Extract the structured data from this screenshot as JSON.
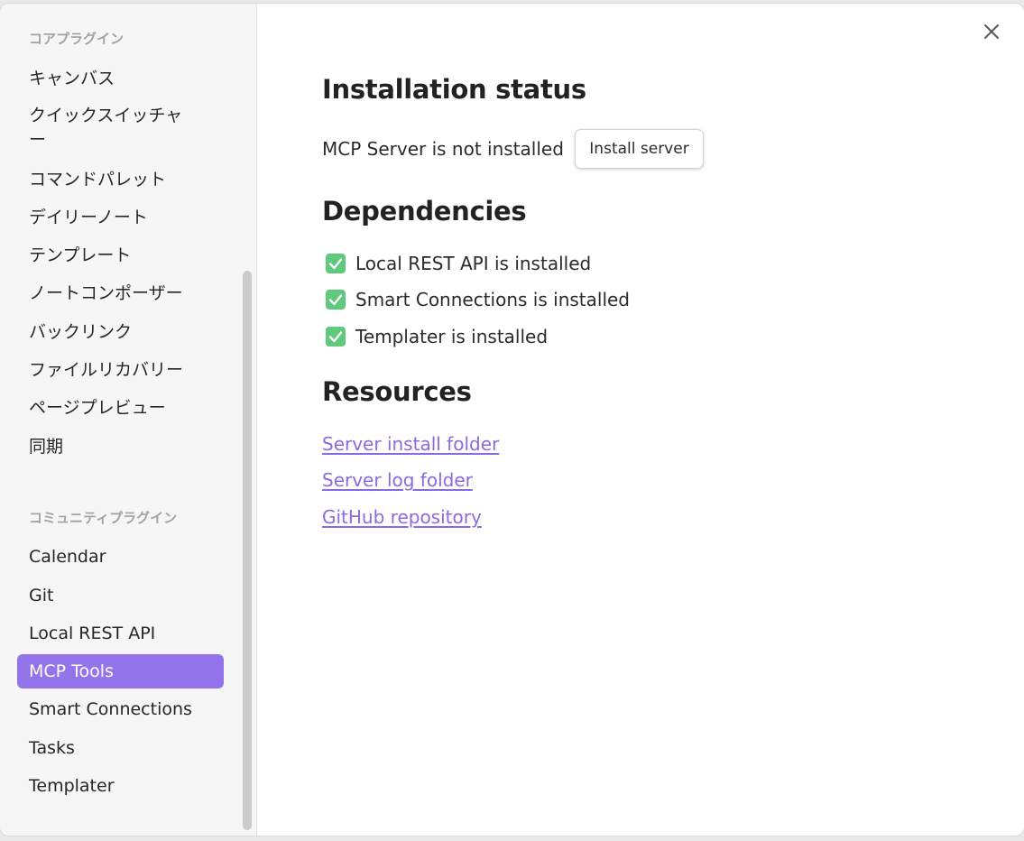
{
  "sidebar": {
    "core_heading": "コアプラグイン",
    "core_items": [
      {
        "label": "キャンバス"
      },
      {
        "label": "クイックスイッチャー"
      },
      {
        "label": "コマンドパレット"
      },
      {
        "label": "デイリーノート"
      },
      {
        "label": "テンプレート"
      },
      {
        "label": "ノートコンポーザー"
      },
      {
        "label": "バックリンク"
      },
      {
        "label": "ファイルリカバリー"
      },
      {
        "label": "ページプレビュー"
      },
      {
        "label": "同期"
      }
    ],
    "community_heading": "コミュニティプラグイン",
    "community_items": [
      {
        "label": "Calendar"
      },
      {
        "label": "Git"
      },
      {
        "label": "Local REST API"
      },
      {
        "label": "MCP Tools",
        "active": true
      },
      {
        "label": "Smart Connections"
      },
      {
        "label": "Tasks"
      },
      {
        "label": "Templater"
      }
    ]
  },
  "content": {
    "installation_heading": "Installation status",
    "server_status": "MCP Server is not installed",
    "install_button": "Install server",
    "dependencies_heading": "Dependencies",
    "dependencies": [
      {
        "label": "Local REST API is installed",
        "checked": true
      },
      {
        "label": "Smart Connections is installed",
        "checked": true
      },
      {
        "label": "Templater is installed",
        "checked": true
      }
    ],
    "resources_heading": "Resources",
    "links": [
      {
        "label": "Server install folder"
      },
      {
        "label": "Server log folder"
      },
      {
        "label": "GitHub repository"
      }
    ]
  },
  "icons": {
    "close": "close-icon",
    "check": "checkbox-checked-icon"
  },
  "colors": {
    "accent": "#9474eb",
    "link": "#8a6ae0",
    "check": "#5fc97c"
  }
}
